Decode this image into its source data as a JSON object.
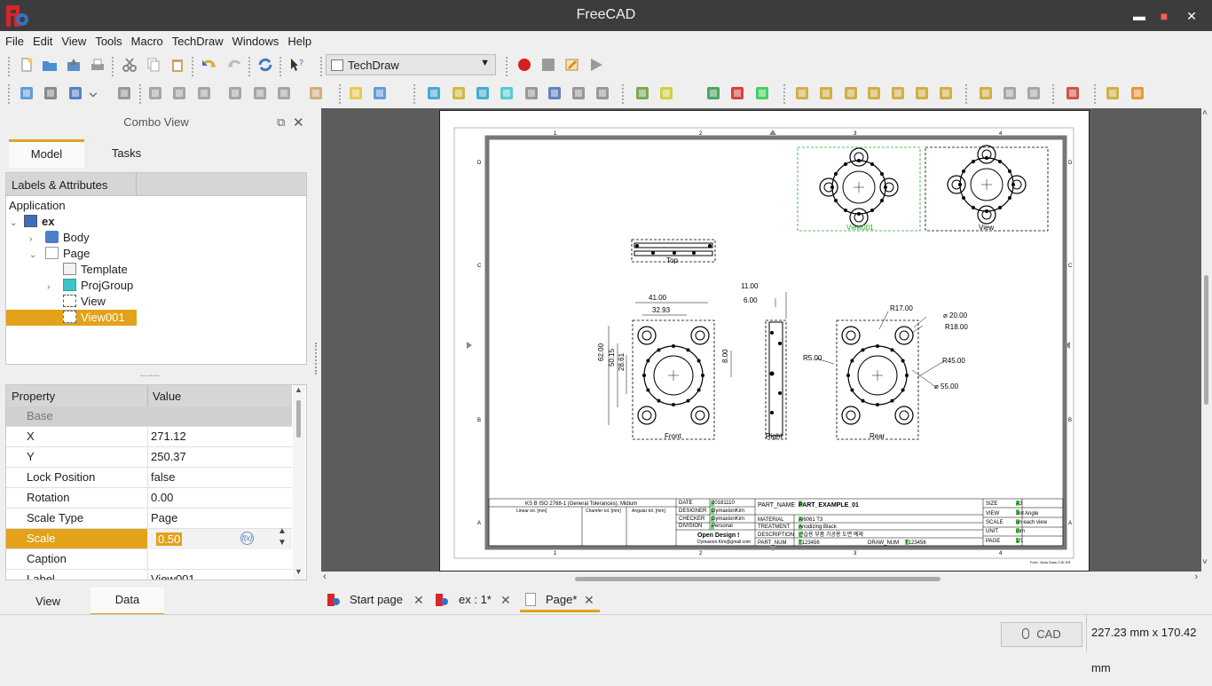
{
  "window": {
    "title": "FreeCAD",
    "minimize": "▬",
    "maximize": "■",
    "close": "✕"
  },
  "menu": [
    "File",
    "Edit",
    "View",
    "Tools",
    "Macro",
    "TechDraw",
    "Windows",
    "Help"
  ],
  "workbench": {
    "selected": "TechDraw"
  },
  "combo": {
    "title": "Combo View",
    "tabs": [
      "Model",
      "Tasks"
    ]
  },
  "tree": {
    "header": "Labels & Attributes",
    "root": "Application",
    "items": [
      {
        "label": "ex"
      },
      {
        "label": "Body"
      },
      {
        "label": "Page"
      },
      {
        "label": "Template"
      },
      {
        "label": "ProjGroup"
      },
      {
        "label": "View"
      },
      {
        "label": "View001"
      }
    ]
  },
  "splitter": "........",
  "properties": {
    "col_property": "Property",
    "col_value": "Value",
    "group": "Base",
    "rows": [
      {
        "key": "X",
        "value": "271.12"
      },
      {
        "key": "Y",
        "value": "250.37"
      },
      {
        "key": "Lock Position",
        "value": "false"
      },
      {
        "key": "Rotation",
        "value": "0.00"
      },
      {
        "key": "Scale Type",
        "value": "Page"
      },
      {
        "key": "Scale",
        "value": "0.50"
      },
      {
        "key": "Caption",
        "value": ""
      },
      {
        "key": "Label",
        "value": "View001"
      }
    ]
  },
  "bottom_tabs": [
    "View",
    "Data"
  ],
  "drawing": {
    "labels": {
      "view001": "View001",
      "view": "View",
      "top": "Top",
      "front": "Front",
      "right": "Right",
      "rear": "Rear"
    },
    "dims": [
      "41.00",
      "32.93",
      "62.00",
      "50.15",
      "28.61",
      "8.00",
      "11.00",
      "6.00",
      "R17.00",
      "⌀ 20.00",
      "R18.00",
      "R5.00",
      "R45.00",
      "⌀ 55.00"
    ],
    "border": {
      "cols": [
        "1",
        "2",
        "3",
        "4"
      ],
      "rows": [
        "D",
        "C",
        "B",
        "A"
      ]
    },
    "title_block": {
      "tolerance_title": "KS B ISO 2768-1 (General Tolerances), Midium",
      "linear": "Linear tol. [mm]",
      "chamfer": "Chamfer tol. [mm]",
      "angular": "Angular tol. [mm]",
      "date_label": "DATE",
      "date": "20181110",
      "designer_label": "DESIGNER",
      "designer": "DymaxionKim",
      "checker_label": "CHECKER",
      "checker": "DymaxionKim",
      "division_label": "DIVISION",
      "division": "Personal",
      "brand": "Open Design !",
      "email": "Dymaxion.Kim@gmail.com",
      "part_name_label": "PART_NAME",
      "part_name": "PART_EXAMPLE_01",
      "material_label": "MATERIAL",
      "material": "Al6061 T3",
      "treatment_label": "TREATMENT",
      "treatment": "Anodizing Black",
      "description_label": "DESCRIPTION",
      "description": "연습용 부품 가공용 도면 예제",
      "part_num_label": "PART_NUM",
      "part_num": "T123456",
      "draw_num_label": "DRAW_NUM",
      "draw_num": "T123456",
      "size_label": "SIZE",
      "size": "A3",
      "view_label": "VIEW",
      "view": "3rd Angle",
      "scale_label": "SCALE",
      "scale": "on each view",
      "unit_label": "UNIT",
      "unit": "mm",
      "page_label": "PAGE",
      "page": "1/1"
    },
    "font_note": "Font : Nota Sans CJK KR"
  },
  "doc_tabs": [
    {
      "label": "Start page"
    },
    {
      "label": "ex : 1*"
    },
    {
      "label": "Page*"
    }
  ],
  "status": {
    "nav": "CAD",
    "dimensions": "227.23 mm x 170.42 mm"
  },
  "colors": {
    "accent": "#e3a21a",
    "titlebar": "#3c3c3c",
    "canvas": "#5c5c5c"
  }
}
